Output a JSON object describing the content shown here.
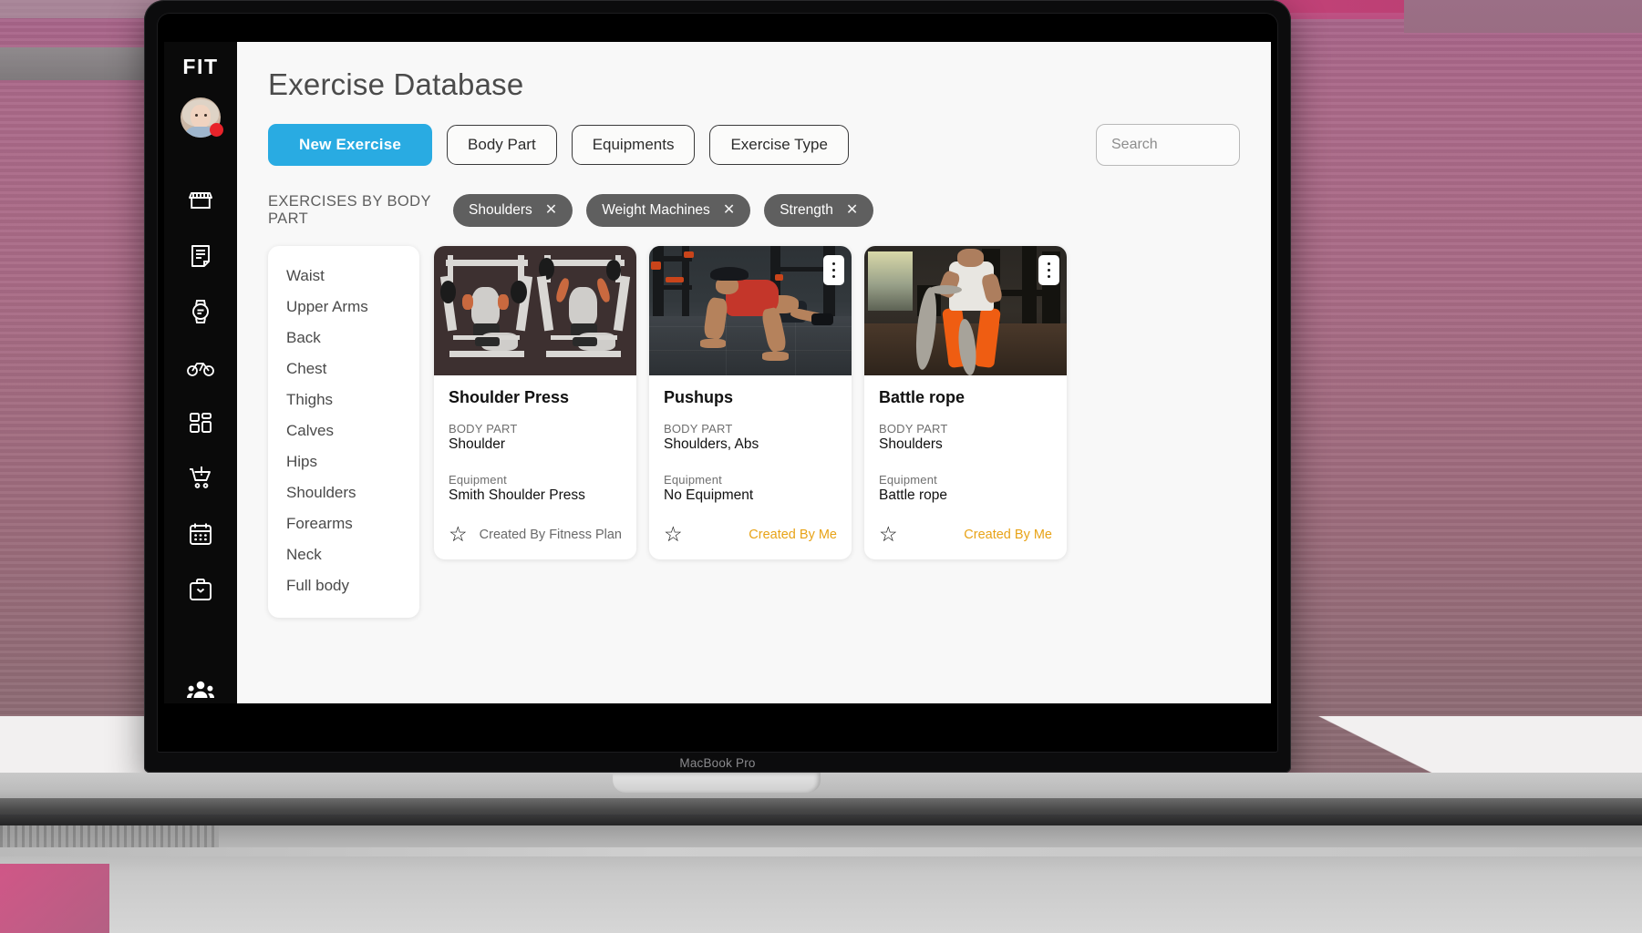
{
  "device": {
    "label": "MacBook Pro"
  },
  "sidebar": {
    "brand": "FIT",
    "avatar_name": "user-avatar",
    "items": [
      {
        "icon": "storefront-icon",
        "name": "sidebar-item-store"
      },
      {
        "icon": "article-icon",
        "name": "sidebar-item-articles"
      },
      {
        "icon": "smartwatch-icon",
        "name": "sidebar-item-devices"
      },
      {
        "icon": "bicycle-icon",
        "name": "sidebar-item-activity"
      },
      {
        "icon": "dashboard-icon",
        "name": "sidebar-item-dashboard"
      },
      {
        "icon": "shopping-cart-icon",
        "name": "sidebar-item-cart"
      },
      {
        "icon": "calendar-icon",
        "name": "sidebar-item-calendar"
      },
      {
        "icon": "briefcase-icon",
        "name": "sidebar-item-plans"
      },
      {
        "icon": "people-icon",
        "name": "sidebar-item-clients"
      }
    ]
  },
  "header": {
    "title": "Exercise Database"
  },
  "toolbar": {
    "new_exercise_label": "New Exercise",
    "filters": [
      {
        "label": "Body Part"
      },
      {
        "label": "Equipments"
      },
      {
        "label": "Exercise Type"
      }
    ],
    "search": {
      "placeholder": "Search",
      "value": ""
    },
    "accent_color": "#29abe2"
  },
  "filters_applied": {
    "section_label": "EXERCISES BY BODY PART",
    "chips": [
      {
        "label": "Shoulders",
        "remove": "✕"
      },
      {
        "label": "Weight Machines",
        "remove": "✕"
      },
      {
        "label": "Strength",
        "remove": "✕"
      }
    ],
    "chip_color": "#5f5f5f"
  },
  "body_parts": {
    "items": [
      {
        "label": "Waist"
      },
      {
        "label": "Upper Arms"
      },
      {
        "label": "Back"
      },
      {
        "label": "Chest"
      },
      {
        "label": "Thighs"
      },
      {
        "label": "Calves"
      },
      {
        "label": "Hips"
      },
      {
        "label": "Shoulders"
      },
      {
        "label": "Forearms"
      },
      {
        "label": "Neck"
      },
      {
        "label": "Full body"
      }
    ]
  },
  "exercises": {
    "body_part_label": "BODY PART",
    "equipment_label": "Equipment",
    "creator_mine_color": "#e8a317",
    "cards": [
      {
        "title": "Shoulder Press",
        "body_part": "Shoulder",
        "equipment": "Smith Shoulder Press",
        "creator": "Created By Fitness Plan",
        "created_by_me": false,
        "image": "shoulder-press-machine-illustration",
        "has_kebab": false
      },
      {
        "title": "Pushups",
        "body_part": "Shoulders, Abs",
        "equipment": "No Equipment",
        "creator": "Created By Me",
        "created_by_me": true,
        "image": "pushup-photo",
        "has_kebab": true
      },
      {
        "title": "Battle rope",
        "body_part": "Shoulders",
        "equipment": "Battle rope",
        "creator": "Created By Me",
        "created_by_me": true,
        "image": "battle-rope-photo",
        "has_kebab": true
      }
    ]
  }
}
